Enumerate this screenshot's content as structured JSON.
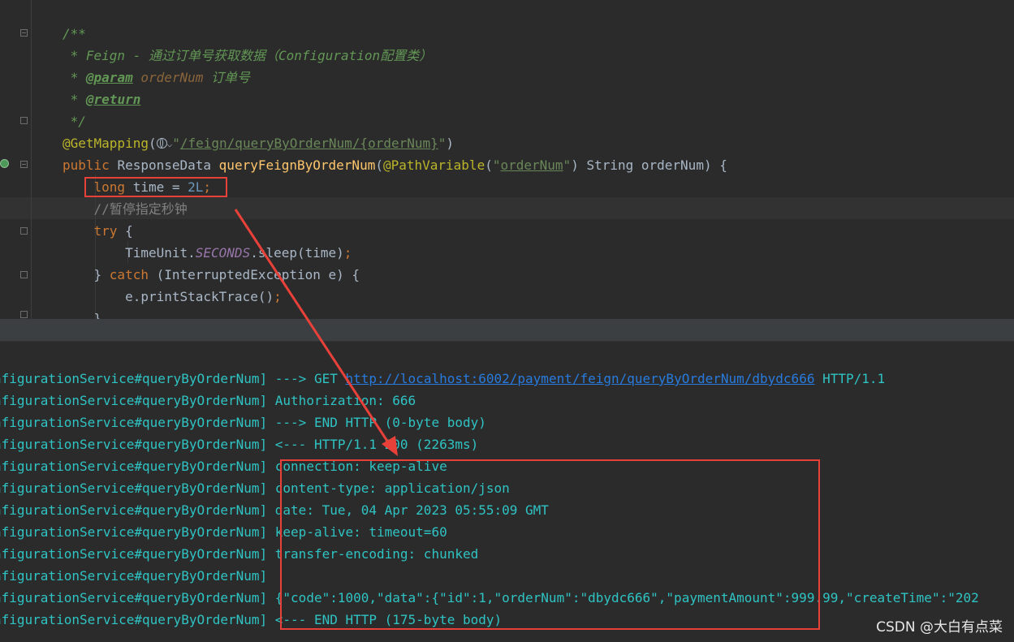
{
  "editor": {
    "lines": [
      {
        "segments": [
          {
            "cls": "c-doc",
            "text": "/**"
          }
        ]
      },
      {
        "segments": [
          {
            "cls": "c-doc",
            "text": " * Feign - 通过订单号获取数据（Configuration配置类）"
          }
        ]
      },
      {
        "segments": [
          {
            "cls": "c-doc",
            "text": " * "
          },
          {
            "cls": "c-tag",
            "text": "@param"
          },
          {
            "cls": "c-doc",
            "text": " "
          },
          {
            "cls": "c-param",
            "text": "orderNum"
          },
          {
            "cls": "c-doc",
            "text": " 订单号"
          }
        ]
      },
      {
        "segments": [
          {
            "cls": "c-doc",
            "text": " * "
          },
          {
            "cls": "c-tag",
            "text": "@return"
          }
        ]
      },
      {
        "segments": [
          {
            "cls": "c-doc",
            "text": " */"
          }
        ]
      },
      {
        "segments": [
          {
            "cls": "c-ann",
            "text": "@GetMapping"
          },
          {
            "cls": "c-text",
            "text": "("
          },
          {
            "cls": "icon",
            "text": ""
          },
          {
            "cls": "c-strq",
            "text": "\""
          },
          {
            "cls": "c-str",
            "text": "/feign/queryByOrderNum/{orderNum}"
          },
          {
            "cls": "c-strq",
            "text": "\""
          },
          {
            "cls": "c-text",
            "text": ")"
          }
        ]
      },
      {
        "segments": [
          {
            "cls": "c-kw",
            "text": "public "
          },
          {
            "cls": "c-text",
            "text": "ResponseData "
          },
          {
            "cls": "c-fn",
            "text": "queryFeignByOrderNum"
          },
          {
            "cls": "c-text",
            "text": "("
          },
          {
            "cls": "c-ann",
            "text": "@PathVariable"
          },
          {
            "cls": "c-text",
            "text": "("
          },
          {
            "cls": "c-strq",
            "text": "\""
          },
          {
            "cls": "c-str",
            "text": "orderNum"
          },
          {
            "cls": "c-strq",
            "text": "\""
          },
          {
            "cls": "c-text",
            "text": ") String orderNum) {"
          }
        ]
      },
      {
        "segments": [
          {
            "cls": "c-text",
            "text": "    "
          },
          {
            "cls": "c-kw",
            "text": "long "
          },
          {
            "cls": "c-text",
            "text": "time = "
          },
          {
            "cls": "c-num",
            "text": "2L"
          },
          {
            "cls": "c-kw",
            "text": ";"
          }
        ]
      },
      {
        "segments": [
          {
            "cls": "c-text",
            "text": "    "
          },
          {
            "cls": "c-cmt",
            "text": "//暂停指定秒钟"
          }
        ]
      },
      {
        "segments": [
          {
            "cls": "c-text",
            "text": "    "
          },
          {
            "cls": "c-kw",
            "text": "try "
          },
          {
            "cls": "c-text",
            "text": "{"
          }
        ]
      },
      {
        "segments": [
          {
            "cls": "c-text",
            "text": "        TimeUnit."
          },
          {
            "cls": "c-const",
            "text": "SECONDS"
          },
          {
            "cls": "c-text",
            "text": ".sleep(time)"
          },
          {
            "cls": "c-kw",
            "text": ";"
          }
        ]
      },
      {
        "segments": [
          {
            "cls": "c-text",
            "text": "    } "
          },
          {
            "cls": "c-kw",
            "text": "catch "
          },
          {
            "cls": "c-text",
            "text": "(InterruptedException e) {"
          }
        ]
      },
      {
        "segments": [
          {
            "cls": "c-text",
            "text": "        e.printStackTrace()"
          },
          {
            "cls": "c-kw",
            "text": ";"
          }
        ]
      },
      {
        "segments": [
          {
            "cls": "c-text",
            "text": "    }"
          }
        ]
      }
    ]
  },
  "console": {
    "prefix": "nfigurationService#queryByOrderNum] ",
    "lines": [
      {
        "text": "---> GET ",
        "link": "http://localhost:6002/payment/feign/queryByOrderNum/dbydc666",
        "after": " HTTP/1.1"
      },
      {
        "text": "Authorization: 666"
      },
      {
        "text": "---> END HTTP (0-byte body)"
      },
      {
        "text": "<--- HTTP/1.1 200 (2263ms)"
      },
      {
        "text": "connection: keep-alive"
      },
      {
        "text": "content-type: application/json"
      },
      {
        "text": "date: Tue, 04 Apr 2023 05:55:09 GMT"
      },
      {
        "text": "keep-alive: timeout=60"
      },
      {
        "text": "transfer-encoding: chunked"
      },
      {
        "text": ""
      },
      {
        "text": "{\"code\":1000,\"data\":{\"id\":1,\"orderNum\":\"dbydc666\",\"paymentAmount\":999.99,\"createTime\":\"202"
      },
      {
        "text": "<--- END HTTP (175-byte body)"
      }
    ]
  },
  "watermark": "CSDN @大白有点菜",
  "colors": {
    "annotation_red": "#e8413a",
    "console_text": "#2fc3c3",
    "link": "#287bde",
    "editor_bg": "#2b2b2b"
  },
  "icons": [
    "globe-icon",
    "chevron-down-icon",
    "run-gutter-icon",
    "fold-icon"
  ]
}
